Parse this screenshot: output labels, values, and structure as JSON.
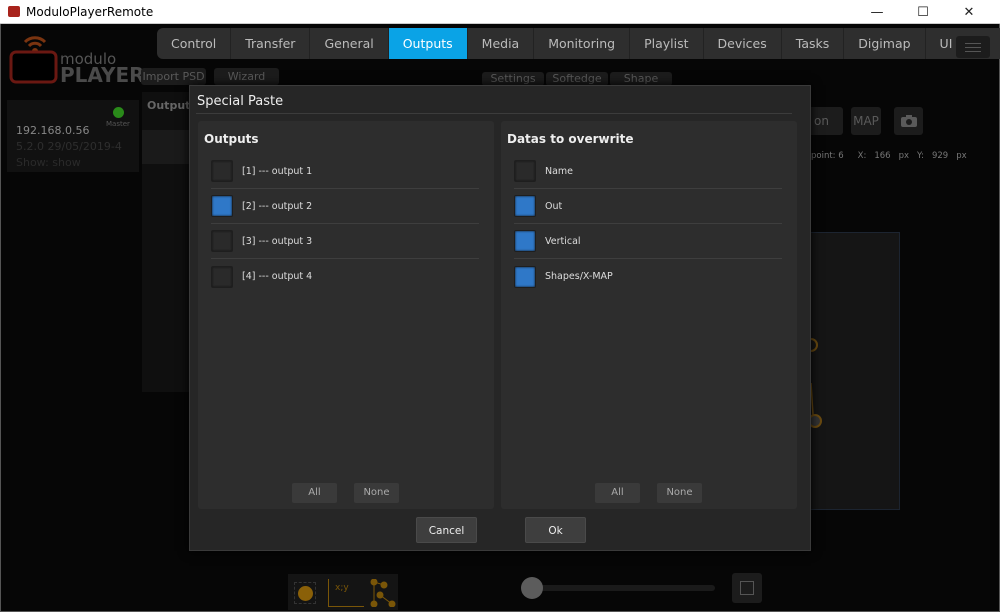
{
  "window": {
    "title": "ModuloPlayerRemote",
    "minimize": "—",
    "maximize": "☐",
    "close": "✕"
  },
  "logo": {
    "line1": "modulo",
    "line2": "PLAYER"
  },
  "tabs": [
    "Control",
    "Transfer",
    "General",
    "Outputs",
    "Media",
    "Monitoring",
    "Playlist",
    "Devices",
    "Tasks",
    "Digimap",
    "UI Designer"
  ],
  "active_tab": "Outputs",
  "toolbar": {
    "import_psd": "Import PSD",
    "wizard": "Wizard"
  },
  "subtabs": [
    "Settings",
    "Softedge",
    "Shape"
  ],
  "device": {
    "ip": "192.168.0.56",
    "version": "5.2.0 29/05/2019-4",
    "show": "Show: show",
    "role": "Master",
    "status_color": "#2a8a1a"
  },
  "outputs_panel_title": "Outputs",
  "right_buttons": {
    "on": "on",
    "map": "MAP"
  },
  "coords": {
    "point": "point: 6",
    "x_label": "X:",
    "x": "166",
    "x_unit": "px",
    "y_label": "Y:",
    "y": "929",
    "y_unit": "px"
  },
  "bottom": {
    "xy_label": "x;y"
  },
  "dialog": {
    "title": "Special Paste",
    "outputs": {
      "title": "Outputs",
      "items": [
        {
          "label": "[1] --- output 1",
          "checked": false
        },
        {
          "label": "[2] --- output 2",
          "checked": true
        },
        {
          "label": "[3] --- output 3",
          "checked": false
        },
        {
          "label": "[4] --- output 4",
          "checked": false
        }
      ],
      "all": "All",
      "none": "None"
    },
    "datas": {
      "title": "Datas to overwrite",
      "items": [
        {
          "label": "Name",
          "checked": false
        },
        {
          "label": "Out",
          "checked": true
        },
        {
          "label": "Vertical",
          "checked": true
        },
        {
          "label": "Shapes/X-MAP",
          "checked": true
        }
      ],
      "all": "All",
      "none": "None"
    },
    "cancel": "Cancel",
    "ok": "Ok"
  },
  "colors": {
    "accent": "#0aa3e6",
    "checkbox_on": "#2f78c8"
  }
}
